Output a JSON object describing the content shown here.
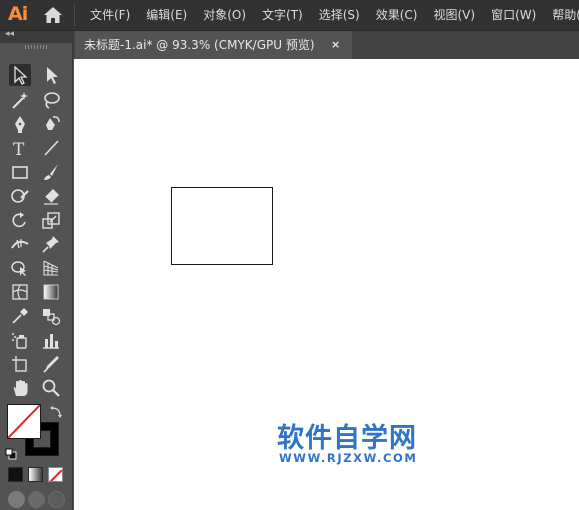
{
  "app": {
    "logo_text": "Ai"
  },
  "menu": {
    "items": [
      {
        "label": "文件(F)"
      },
      {
        "label": "编辑(E)"
      },
      {
        "label": "对象(O)"
      },
      {
        "label": "文字(T)"
      },
      {
        "label": "选择(S)"
      },
      {
        "label": "效果(C)"
      },
      {
        "label": "视图(V)"
      },
      {
        "label": "窗口(W)"
      },
      {
        "label": "帮助(H)"
      }
    ]
  },
  "toolbar": {
    "collapse_glyph": "◂◂",
    "type_tool_glyph": "T",
    "tools": [
      "selection-tool-icon",
      "direct-selection-tool-icon",
      "magic-wand-tool-icon",
      "lasso-tool-icon",
      "pen-tool-icon",
      "curvature-tool-icon",
      "type-tool-icon",
      "line-segment-tool-icon",
      "rectangle-tool-icon",
      "paintbrush-tool-icon",
      "shaper-tool-icon",
      "eraser-tool-icon",
      "rotate-tool-icon",
      "scale-tool-icon",
      "width-tool-icon",
      "puppet-warp-tool-icon",
      "shape-builder-tool-icon",
      "perspective-grid-tool-icon",
      "mesh-tool-icon",
      "gradient-tool-icon",
      "eyedropper-tool-icon",
      "blend-tool-icon",
      "symbol-sprayer-tool-icon",
      "column-graph-tool-icon",
      "artboard-tool-icon",
      "slice-tool-icon",
      "hand-tool-icon",
      "zoom-tool-icon"
    ],
    "active_tool": "selection-tool-icon",
    "fill_color": "#ffffff",
    "stroke_color": "#000000"
  },
  "document": {
    "tab_label": "未标题-1.ai* @ 93.3% (CMYK/GPU 预览)",
    "close_glyph": "×"
  },
  "canvas": {
    "background": "#ffffff",
    "watermark_title": "软件自学网",
    "watermark_url": "WWW.RJZXW.COM",
    "watermark_color": "#2f74c6"
  },
  "colors": {
    "ui_bg": "#535353",
    "menubar_bg": "#323232",
    "logo": "#ff8a3d"
  }
}
